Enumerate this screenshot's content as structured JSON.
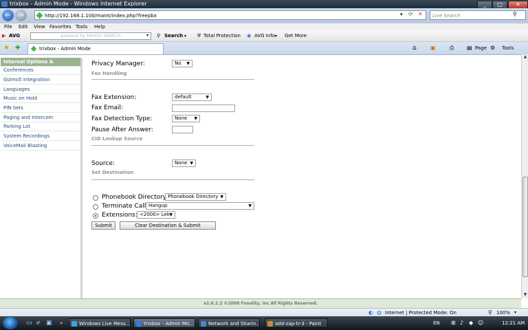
{
  "window": {
    "title": "trixbox - Admin Mode - Windows Internet Explorer",
    "btn_min": "_",
    "btn_max": "□",
    "btn_close": "✕"
  },
  "browser": {
    "address": "http://192.168.1.100/maint/index.php?freepbx",
    "search_placeholder": "Live Search",
    "back_glyph": "←",
    "forward_glyph": "→",
    "menu": [
      "File",
      "Edit",
      "View",
      "Favorites",
      "Tools",
      "Help"
    ],
    "avg": {
      "logo": "AVG",
      "search_placeholder": "powered by YAHOO! SEARCH",
      "search_label": "Search",
      "total_protection": "Total Protection",
      "avg_info": "AVG Info",
      "get_more": "Get More"
    },
    "tab_title": "trixbox - Admin Mode",
    "tools": {
      "page": "Page",
      "tools": "Tools"
    }
  },
  "sidebar": {
    "items": [
      {
        "label": "Internal Options & Configuration",
        "active": true
      },
      {
        "label": "Conferences"
      },
      {
        "label": "Gizmo5 Integration"
      },
      {
        "label": "Languages"
      },
      {
        "label": "Music on Hold"
      },
      {
        "label": "PIN Sets"
      },
      {
        "label": "Paging and Intercom"
      },
      {
        "label": "Parking Lot"
      },
      {
        "label": "System Recordings"
      },
      {
        "label": "VoiceMail Blasting"
      }
    ]
  },
  "form": {
    "privacy_manager": {
      "label": "Privacy Manager:",
      "value": "No"
    },
    "fax_section": "Fax Handling",
    "fax_extension": {
      "label": "Fax Extension:",
      "value": "default"
    },
    "fax_email": {
      "label": "Fax Email:",
      "value": ""
    },
    "fax_detection": {
      "label": "Fax Detection Type:",
      "value": "None"
    },
    "pause_after_answer": {
      "label": "Pause After Answer:",
      "value": ""
    },
    "cid_section": "CID Lookup Source",
    "source": {
      "label": "Source:",
      "value": "None"
    },
    "dest_section": "Set Destination",
    "dest_phonebook": {
      "label": "Phonebook Directory:",
      "value": "Phonebook Directory",
      "selected": false
    },
    "dest_terminate": {
      "label": "Terminate Call:",
      "value": "Hangup",
      "selected": false
    },
    "dest_extensions": {
      "label": "Extensions:",
      "value": "<2000> Lek",
      "selected": true
    },
    "submit_label": "Submit",
    "clear_submit_label": "Clear Destination & Submit"
  },
  "footer": "v2.6.2.2 ©2008 Fonality, inc All Rights Reserved.",
  "statusbar": {
    "zone": "Internet | Protected Mode: On",
    "zoom": "100%"
  },
  "taskbar": {
    "tasks": [
      {
        "label": "Windows Live Mess...",
        "color": "#3aa3e0"
      },
      {
        "label": "trixbox - Admin Mo...",
        "color": "#3a7bd5"
      },
      {
        "label": "Network and Sharin...",
        "color": "#4a88c7"
      },
      {
        "label": "add-zap-tr-3 - Paint",
        "color": "#d08a3a"
      }
    ],
    "lang": "EN",
    "clock": "12:21 AM"
  }
}
